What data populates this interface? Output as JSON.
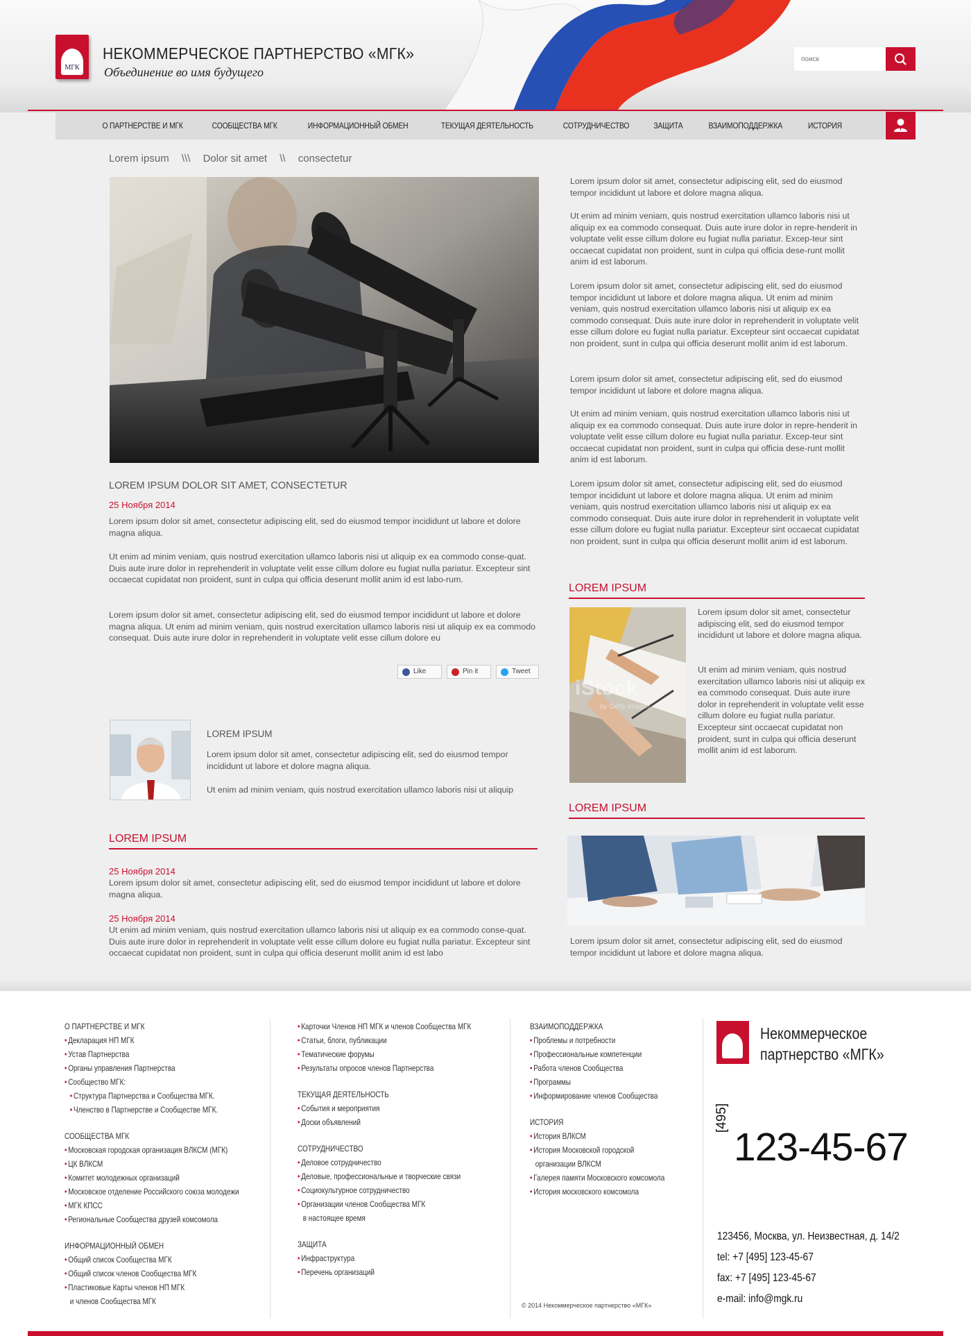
{
  "header": {
    "title": "НЕКОММЕРЧЕСКОЕ ПАРТНЕРСТВО «МГК»",
    "subtitle": "Объединение во имя будущего",
    "logo_text": "МГК",
    "search_placeholder": "поиск"
  },
  "nav": {
    "items": [
      "О ПАРТНЕРСТВЕ И МГК",
      "СООБЩЕСТВА МГК",
      "ИНФОРМАЦИОННЫЙ ОБМЕН",
      "ТЕКУЩАЯ ДЕЯТЕЛЬНОСТЬ",
      "СОТРУДНИЧЕСТВО",
      "ЗАЩИТА",
      "ВЗАИМОПОДДЕРЖКА",
      "ИСТОРИЯ"
    ]
  },
  "breadcrumb": {
    "items": [
      "Lorem ipsum",
      "\\\\\\",
      "Dolor sit amet",
      "\\\\",
      "consectetur"
    ]
  },
  "article": {
    "title": "LOREM IPSUM DOLOR SIT AMET, CONSECTETUR",
    "date": "25 Ноября 2014",
    "p1": "Lorem ipsum dolor sit amet, consectetur adipiscing elit, sed do eiusmod tempor incididunt ut labore et dolore magna aliqua.",
    "p2": "Ut enim ad minim veniam, quis nostrud exercitation ullamco laboris nisi ut aliquip ex ea commodo conse-quat. Duis aute irure dolor in reprehenderit in voluptate velit esse cillum dolore eu fugiat nulla pariatur. Excepteur sint occaecat cupidatat non proident, sunt in culpa qui officia deserunt mollit anim id est labo-rum.",
    "p3": "Lorem ipsum dolor sit amet, consectetur adipiscing elit, sed do eiusmod tempor incididunt ut labore et dolore magna aliqua. Ut enim ad minim veniam, quis nostrud exercitation ullamco laboris nisi ut aliquip ex ea commodo consequat. Duis aute irure dolor in reprehenderit in voluptate velit esse cillum dolore eu",
    "share": {
      "like": "Like",
      "pin": "Pin it",
      "tweet": "Tweet"
    }
  },
  "person": {
    "title": "LOREM IPSUM",
    "p1": "Lorem ipsum dolor sit amet, consectetur adipiscing elit, sed do eiusmod tempor incididunt ut labore et dolore magna aliqua.",
    "p2": "Ut enim ad minim veniam, quis nostrud exercitation ullamco laboris nisi ut aliquip"
  },
  "news": {
    "title": "LOREM IPSUM",
    "items": [
      {
        "date": "25 Ноября 2014",
        "text": "Lorem ipsum dolor sit amet, consectetur adipiscing elit, sed do eiusmod tempor incididunt ut labore et dolore magna aliqua."
      },
      {
        "date": "25 Ноября 2014",
        "text": "Ut enim ad minim veniam, quis nostrud exercitation ullamco laboris nisi ut aliquip ex ea commodo conse-quat. Duis aute irure dolor in reprehenderit in voluptate velit esse cillum dolore eu fugiat nulla pariatur. Excepteur sint occaecat cupidatat non proident, sunt in culpa qui officia deserunt mollit anim id est labo"
      }
    ]
  },
  "right": {
    "p1": "Lorem ipsum dolor sit amet, consectetur adipiscing elit, sed do eiusmod tempor incididunt ut labore et dolore magna aliqua.",
    "p2": "Ut enim ad minim veniam, quis nostrud exercitation ullamco laboris nisi ut aliquip ex ea commodo consequat. Duis aute irure dolor in repre-henderit in voluptate velit esse cillum dolore eu fugiat nulla pariatur. Excep-teur sint occaecat cupidatat non proident, sunt in culpa qui officia dese-runt mollit anim id est laborum.",
    "p3": "Lorem ipsum dolor sit amet, consectetur adipiscing elit, sed do eiusmod tempor incididunt ut labore et dolore magna aliqua. Ut enim ad minim veniam, quis nostrud exercitation ullamco laboris nisi ut aliquip ex ea commodo consequat. Duis aute irure dolor in reprehenderit in voluptate velit esse cillum dolore eu fugiat nulla pariatur. Excepteur sint occaecat cupidatat non proident, sunt in culpa qui officia deserunt mollit anim id est laborum.",
    "p4": "Lorem ipsum dolor sit amet, consectetur adipiscing elit, sed do eiusmod tempor incididunt ut labore et dolore magna aliqua.",
    "p5": "Ut enim ad minim veniam, quis nostrud exercitation ullamco laboris nisi ut aliquip ex ea commodo consequat. Duis aute irure dolor in repre-henderit in voluptate velit esse cillum dolore eu fugiat nulla pariatur. Excep-teur sint occaecat cupidatat non proident, sunt in culpa qui officia dese-runt mollit anim id est laborum.",
    "p6": "Lorem ipsum dolor sit amet, consectetur adipiscing elit, sed do eiusmod tempor incididunt ut labore et dolore magna aliqua. Ut enim ad minim veniam, quis nostrud exercitation ullamco laboris nisi ut aliquip ex ea commodo consequat. Duis aute irure dolor in reprehenderit in voluptate velit esse cillum dolore eu fugiat nulla pariatur. Excepteur sint occaecat cupidatat non proident, sunt in culpa qui officia deserunt mollit anim id est laborum.",
    "block1_title": "LOREM IPSUM",
    "block1_p1": "Lorem ipsum dolor sit amet, consectetur adipiscing elit, sed do eiusmod tempor incididunt ut labore et dolore magna aliqua.",
    "block1_p2": "Ut enim ad minim veniam, quis nostrud exercitation ullamco laboris nisi ut aliquip ex ea commodo consequat. Duis aute irure dolor in reprehenderit in voluptate velit esse cillum dolore eu fugiat nulla pariatur. Excepteur sint occaecat cupidatat non proident, sunt in culpa qui officia deserunt mollit anim id est laborum.",
    "block2_title": "LOREM IPSUM",
    "block2_p": "Lorem ipsum dolor sit amet, consectetur adipiscing elit, sed do eiusmod tempor incididunt ut labore et dolore magna aliqua.",
    "watermark": "iStock",
    "watermark_sub": "by Getty Images"
  },
  "footer": {
    "col1": [
      {
        "type": "h",
        "t": "О ПАРТНЕРСТВЕ И МГК"
      },
      {
        "type": "i",
        "t": "Декларация НП МГК"
      },
      {
        "type": "i",
        "t": "Устав Партнерства"
      },
      {
        "type": "i",
        "t": "Органы управления Партнерства"
      },
      {
        "type": "i",
        "t": "Сообщество МГК:"
      },
      {
        "type": "s",
        "t": "Структура Партнерства и Сообщества МГК."
      },
      {
        "type": "s",
        "t": "Членство в Партнерстве и Сообществе МГК."
      },
      {
        "type": "h",
        "t": "СООБЩЕСТВА МГК"
      },
      {
        "type": "i",
        "t": "Московская городская организация ВЛКСМ (МГК)"
      },
      {
        "type": "i",
        "t": "ЦК ВЛКСМ"
      },
      {
        "type": "i",
        "t": "Комитет молодежных организаций"
      },
      {
        "type": "i",
        "t": "Московское отделение Российского союза молодежи"
      },
      {
        "type": "i",
        "t": "МГК КПСС"
      },
      {
        "type": "i",
        "t": "Региональные Сообщества друзей комсомола"
      },
      {
        "type": "h",
        "t": "ИНФОРМАЦИОННЫЙ ОБМЕН"
      },
      {
        "type": "i",
        "t": "Общий список Сообщества МГК"
      },
      {
        "type": "i",
        "t": "Общий список членов Сообщества МГК"
      },
      {
        "type": "i",
        "t": "Пластиковые Карты членов НП МГК"
      },
      {
        "type": "c",
        "t": "и членов Сообщества МГК"
      }
    ],
    "col2": [
      {
        "type": "i",
        "t": "Карточки Членов НП МГК и членов Сообщества МГК"
      },
      {
        "type": "i",
        "t": "Статьи, блоги, публикации"
      },
      {
        "type": "i",
        "t": "Тематические форумы"
      },
      {
        "type": "i",
        "t": "Результаты опросов членов Партнерства"
      },
      {
        "type": "h",
        "t": "ТЕКУЩАЯ ДЕЯТЕЛЬНОСТЬ"
      },
      {
        "type": "i",
        "t": "События и мероприятия"
      },
      {
        "type": "i",
        "t": "Доски объявлений"
      },
      {
        "type": "h",
        "t": "СОТРУДНИЧЕСТВО"
      },
      {
        "type": "i",
        "t": "Деловое сотрудничество"
      },
      {
        "type": "i",
        "t": "Деловые, профессиональные и творческие связи"
      },
      {
        "type": "i",
        "t": "Социокультурное сотрудничество"
      },
      {
        "type": "i",
        "t": "Организации членов Сообщества МГК"
      },
      {
        "type": "c",
        "t": "в настоящее время"
      },
      {
        "type": "h",
        "t": "ЗАЩИТА"
      },
      {
        "type": "i",
        "t": "Инфраструктура"
      },
      {
        "type": "i",
        "t": "Перечень организаций"
      }
    ],
    "col3": [
      {
        "type": "h",
        "t": "ВЗАИМОПОДДЕРЖКА"
      },
      {
        "type": "i",
        "t": "Проблемы и потребности"
      },
      {
        "type": "i",
        "t": "Профессиональные компетенции"
      },
      {
        "type": "i",
        "t": "Работа членов Сообщества"
      },
      {
        "type": "i",
        "t": "Программы"
      },
      {
        "type": "i",
        "t": "Информирование членов Сообщества"
      },
      {
        "type": "h",
        "t": "ИСТОРИЯ"
      },
      {
        "type": "i",
        "t": "История ВЛКСМ"
      },
      {
        "type": "i",
        "t": "История Московской городской"
      },
      {
        "type": "c",
        "t": "организации ВЛКСМ"
      },
      {
        "type": "i",
        "t": "Галерея памяти Московского комсомола"
      },
      {
        "type": "i",
        "t": "История московского комсомола"
      }
    ],
    "copyright": "© 2014  Некоммерческое партнерство  «МГК»",
    "org_name_1": "Некоммерческое",
    "org_name_2": "партнерство «МГК»",
    "phone_code": "495",
    "phone": "123-45-67",
    "address": "123456, Москва, ул. Неизвестная, д. 14/2",
    "tel": "tel: +7 [495] 123-45-67",
    "fax": "fax: +7 [495] 123-45-67",
    "email": "e-mail: info@mgk.ru"
  },
  "colors": {
    "accent": "#c8102e",
    "background": "#efeff0"
  }
}
